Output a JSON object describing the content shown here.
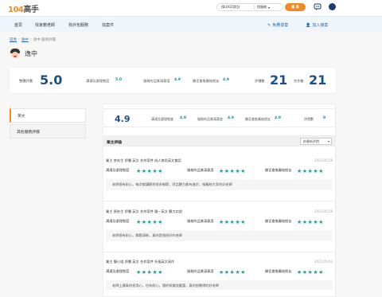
{
  "header": {
    "logo_num": "104",
    "logo_text": "高手",
    "search_value": "找LOGO設計",
    "search_type": "找服務",
    "search_button": "搜 尋"
  },
  "nav": {
    "items": [
      "首頁",
      "找家教老師",
      "找外包服務",
      "找案件"
    ],
    "post_free": "免費發案",
    "join_expert": "加入接案"
  },
  "breadcrumb": [
    "首頁",
    "逸中",
    "逸中 服務評價"
  ],
  "profile": {
    "name": "逸中"
  },
  "overall": {
    "overall_label": "整體評價",
    "overall_score": "5.0",
    "c1_label": "溝通及處理態度",
    "c1_value": "5.0",
    "c2_label": "服務的品質滿意度",
    "c2_value": "4.9",
    "c3_label": "願否會推薦給朋友",
    "c3_value": "4.9",
    "reviews_label": "評價數",
    "reviews_count": "21",
    "cases_label": "合作數",
    "cases_count": "21"
  },
  "side_tabs": [
    "英文",
    "其他服務評價"
  ],
  "summary": {
    "score": "4.9",
    "c1_label": "溝通及處理態度",
    "c1_value": "4.9",
    "c2_label": "服務的品質滿意度",
    "c2_value": "4.9",
    "c3_label": "願否會推薦給朋友",
    "c3_value": "4.9",
    "reviews_label": "評價數",
    "reviews_count": "9"
  },
  "reviews_header": {
    "title": "業主評論",
    "sort": "依最新評價"
  },
  "rating_labels": [
    "溝通及處理態度",
    "服務的品質滿意度",
    "願否會推薦給朋友"
  ],
  "reviews": [
    {
      "meta": "業主 李先生 評價 英文 合作案件 成人商用英文會話",
      "date": "2021/05/18",
      "comment": "老師很有耐心，每次都講解到很多細節，對話聽力都有進步，推薦給大家的好老師"
    },
    {
      "meta": "業主 張先生 評價 英文 合作案件 國一英文 聽力口說",
      "date": "2021/05/18",
      "comment": "老師很有耐心，解題清晰，真的是個很好的老師"
    },
    {
      "meta": "業主 簡小姐 評價 英文 合作案件 托福英文寫作",
      "date": "2021/05/03",
      "comment": "老師上課真的很用心，也有耐心，懂的知識很豐富，真的很難得的好老師"
    }
  ],
  "colors": {
    "accent": "#f08a24",
    "score_blue": "#1c4f86",
    "star_teal": "#2a9d8f",
    "value_teal": "#2a8a8a"
  }
}
